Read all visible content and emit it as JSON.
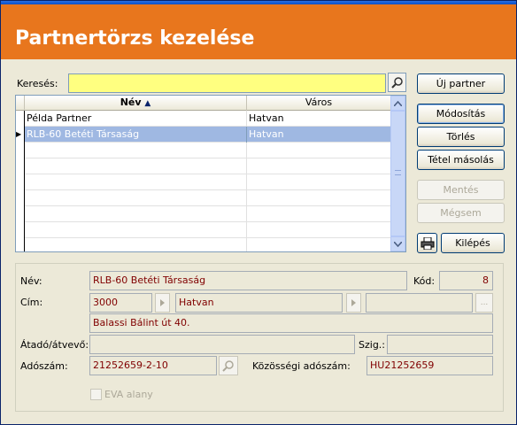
{
  "header": {
    "title": "Partnertörzs kezelése"
  },
  "search": {
    "label": "Keresés:",
    "value": ""
  },
  "grid": {
    "columns": [
      "Név",
      "Város"
    ],
    "rows": [
      {
        "name": "Példa Partner",
        "city": "Hatvan",
        "selected": false
      },
      {
        "name": "RLB-60 Betéti Társaság",
        "city": "Hatvan",
        "selected": true
      }
    ]
  },
  "buttons": {
    "new": "Új partner",
    "modify": "Módosítás",
    "delete": "Törlés",
    "copy": "Tétel másolás",
    "save": "Mentés",
    "cancel": "Mégsem",
    "exit": "Kilépés"
  },
  "details": {
    "name_label": "Név:",
    "name": "RLB-60 Betéti Társaság",
    "code_label": "Kód:",
    "code": "8",
    "address_label": "Cím:",
    "zip": "3000",
    "city": "Hatvan",
    "street_extra": "",
    "street": "Balassi Bálint út 40.",
    "receiver_label": "Átadó/átvevő:",
    "receiver": "",
    "id_label": "Szig.:",
    "id_value": "",
    "tax_label": "Adószám:",
    "tax": "21252659-2-10",
    "eu_tax_label": "Közösségi adószám:",
    "eu_tax": "HU21252659",
    "eva_label": "EVA alany"
  }
}
